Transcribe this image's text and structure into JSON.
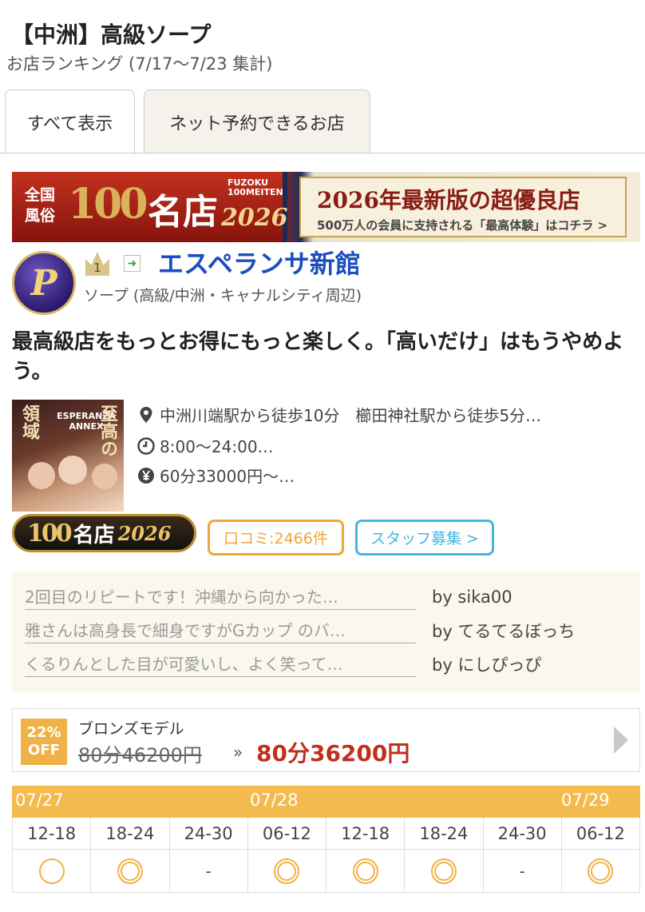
{
  "header": {
    "area_title": "【中洲】高級ソープ",
    "subtitle": "お店ランキング (7/17〜7/23 集計)"
  },
  "tabs": [
    {
      "label": "すべて表示",
      "active": true
    },
    {
      "label": "ネット予約できるお店",
      "active": false
    }
  ],
  "banner": {
    "left_kanji": "全国風俗",
    "left_100": "100",
    "left_meiten": "名店",
    "left_fuzoku": "FUZOKU 100MEITEN",
    "left_year": "2026",
    "right_title": "2026年最新版の超優良店",
    "right_sub": "500万人の会員に支持される「最高体験」はコチラ >"
  },
  "shop": {
    "rank": "1",
    "logo_letter": "P",
    "name": "エスペランサ新館",
    "genre": "ソープ (高級/中洲・キャナルシティ周辺)",
    "catch_copy": "最高級店をもっとお得にもっと楽しく。「高いだけ」はもうやめよう。",
    "photo_text_left": "領域",
    "photo_text_right": "至高の",
    "photo_brand": "ESPERANZA ANNEX",
    "access": "中洲川端駅から徒歩10分　櫛田神社駅から徒歩5分…",
    "hours": "8:00〜24:00…",
    "price": "60分33000円〜…",
    "badge_100": "100",
    "badge_meiten": "名店",
    "badge_year": "2026",
    "review_count_label": "口コミ:2466件",
    "staff_label": "スタッフ募集 >"
  },
  "icons": {
    "access": "map-pin-icon",
    "hours": "clock-icon",
    "price": "yen-icon"
  },
  "reviews": [
    {
      "text": "2回目のリピートです！沖縄から向かった…",
      "by": "by sika00"
    },
    {
      "text": "雅さんは高身長で細身ですがGカップ のバ…",
      "by": "by てるてるぼっち"
    },
    {
      "text": "くるりんとした目が可愛いし、よく笑って…",
      "by": "by にしぴっぴ"
    }
  ],
  "course": {
    "discount_pct": "22%",
    "discount_off": "OFF",
    "name": "ブロンズモデル",
    "original_price": "80分46200円",
    "arrow": "»",
    "sale_price": "80分36200円"
  },
  "schedule": {
    "dates": [
      "07/27",
      "07/28",
      "07/29"
    ],
    "slots": [
      "12-18",
      "18-24",
      "24-30",
      "06-12",
      "12-18",
      "18-24",
      "24-30",
      "06-12"
    ],
    "marks": [
      "○",
      "◎",
      "-",
      "◎",
      "◎",
      "◎",
      "-",
      "◎"
    ]
  },
  "colors": {
    "shop_name": "#1a4dbf",
    "review_border": "#f0a53a",
    "staff_border": "#45b5e0",
    "schedule_header": "#f3bb4e",
    "sale_price": "#c0301f"
  }
}
